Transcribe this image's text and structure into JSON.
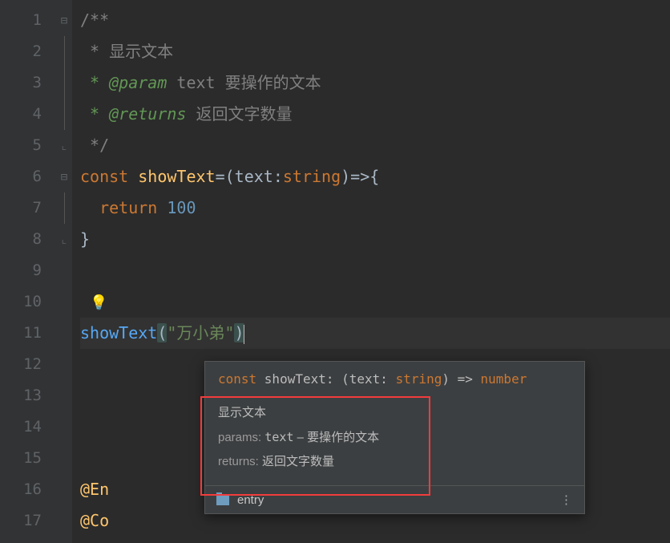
{
  "gutter": {
    "lines": [
      "1",
      "2",
      "3",
      "4",
      "5",
      "6",
      "7",
      "8",
      "9",
      "10",
      "11",
      "12",
      "13",
      "14",
      "15",
      "16",
      "17"
    ]
  },
  "code": {
    "jsdoc_open": "/**",
    "jsdoc_desc_star": " * ",
    "jsdoc_desc": "显示文本",
    "jsdoc_param_tag": " * @param ",
    "jsdoc_param_name": "text",
    "jsdoc_param_desc": " 要操作的文本",
    "jsdoc_returns_tag": " * @returns ",
    "jsdoc_returns_desc": "返回文字数量",
    "jsdoc_close": " */",
    "const_kw": "const ",
    "fn_name": "showText",
    "eq": "=",
    "lparen": "(",
    "param": "text",
    "colon": ":",
    "ptype": "string",
    "rparen_arrow_brace": ")=>{",
    "return_kw": "return ",
    "return_val": "100",
    "close_brace": "}",
    "bulb": "💡",
    "call_fn": "showText",
    "call_lp": "(",
    "call_arg": "\"万小弟\"",
    "call_rp": ")",
    "anno_en": "@En",
    "anno_co": "@Co"
  },
  "tooltip": {
    "sig_const": "const ",
    "sig_name": "showText",
    "sig_colon": ": ",
    "sig_lp": "(",
    "sig_param": "text",
    "sig_pc": ": ",
    "sig_ptype": "string",
    "sig_rp": ")",
    "sig_arrow": " => ",
    "sig_ret": "number",
    "doc_desc": "显示文本",
    "doc_params_label": "params:",
    "doc_param_name": "text",
    "doc_param_sep": " – ",
    "doc_param_desc": "要操作的文本",
    "doc_returns_label": "returns:",
    "doc_returns_desc": "返回文字数量",
    "foot_label": "entry",
    "foot_more": "⋮"
  }
}
